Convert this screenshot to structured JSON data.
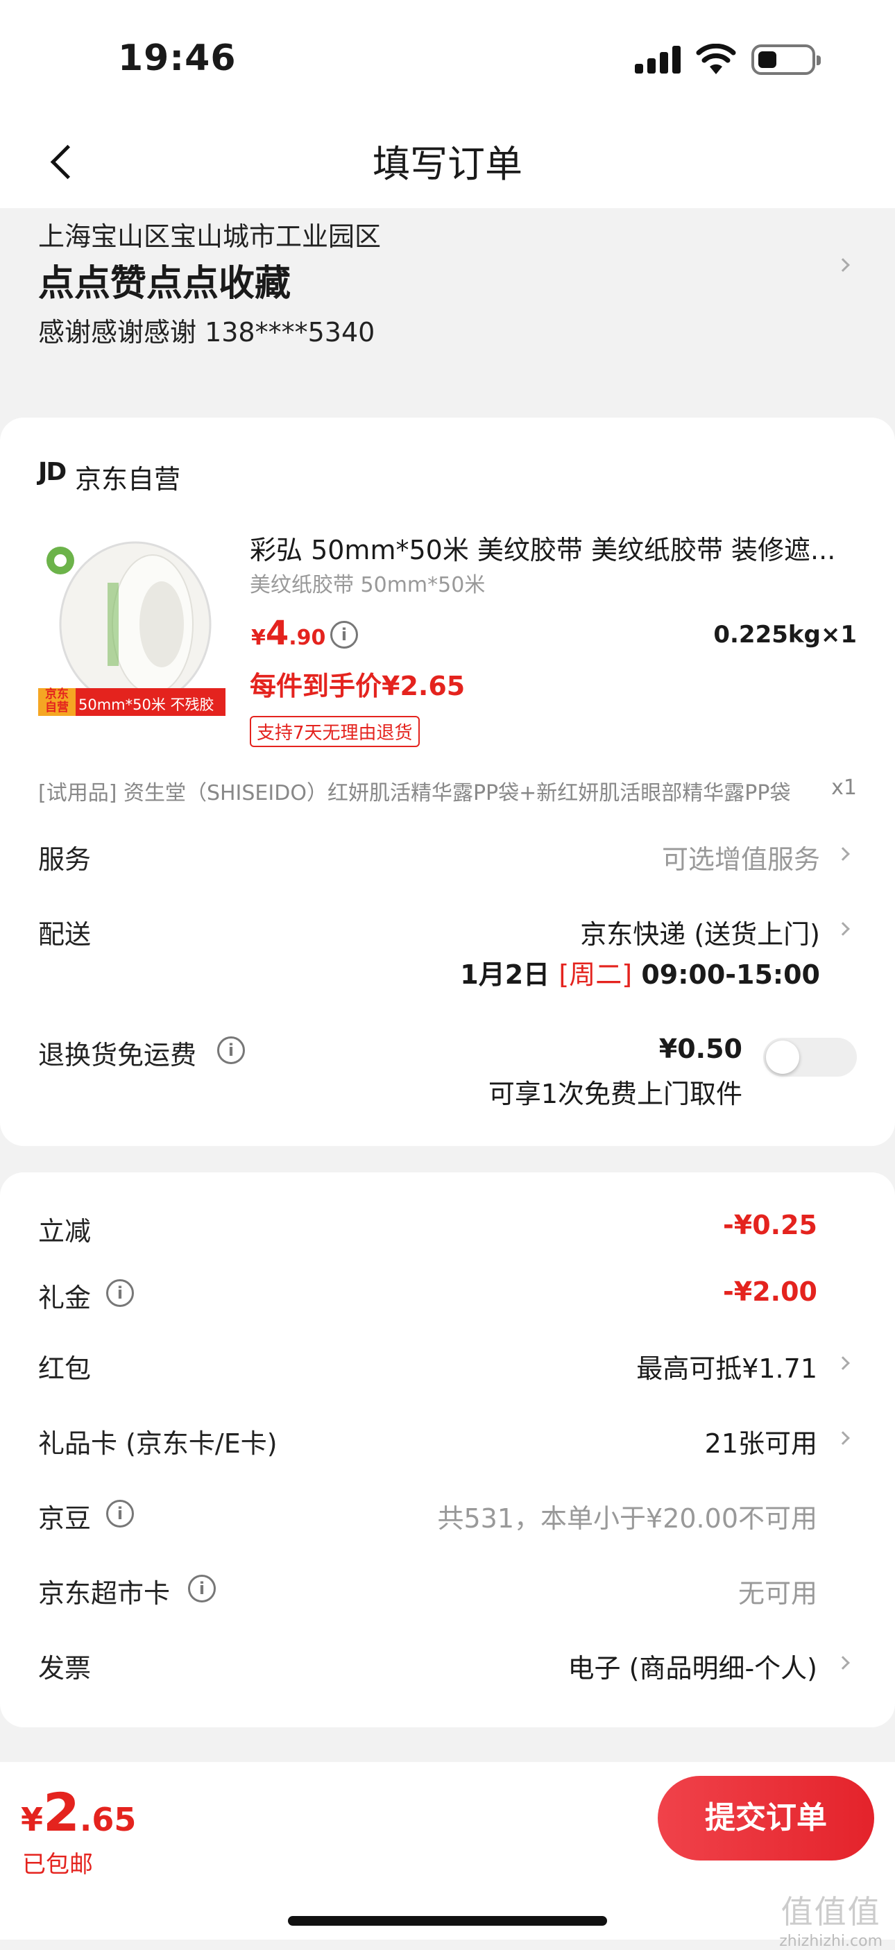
{
  "status": {
    "time": "19:46"
  },
  "header": {
    "title": "填写订单"
  },
  "address": {
    "region": "上海宝山区宝山城市工业园区",
    "name": "点点赞点点收藏",
    "contact": "感谢感谢感谢  138****5340"
  },
  "shop": {
    "logo": "JD",
    "name": "京东自营"
  },
  "product": {
    "name": "彩弘 50mm*50米 美纹胶带 美纹纸胶带 装修遮...",
    "spec": "美纹纸胶带 50mm*50米",
    "price_symbol": "¥",
    "price_int": "4",
    "price_dec": ".90",
    "weight_qty": "0.225kg×1",
    "final_price": "每件到手价¥2.65",
    "return_tag": "支持7天无理由退货",
    "image_badge_left": "京东\n自营",
    "image_badge_right": "50mm*50米 不残胶"
  },
  "trial": {
    "text": "[试用品] 资生堂（SHISEIDO）红妍肌活精华露PP袋+新红妍肌活眼部精华露PP袋",
    "qty": "x1"
  },
  "service": {
    "label": "服务",
    "value": "可选增值服务"
  },
  "delivery": {
    "label": "配送",
    "method": "京东快递 (送货上门)",
    "date": "1月2日",
    "weekday": "[周二]",
    "time": "09:00-15:00"
  },
  "return_shipping": {
    "label": "退换货免运费",
    "price": "¥0.50",
    "desc": "可享1次免费上门取件",
    "enabled": false
  },
  "discounts": {
    "instant": {
      "label": "立减",
      "value": "-¥0.25"
    },
    "gift_money": {
      "label": "礼金",
      "value": "-¥2.00"
    },
    "red_packet": {
      "label": "红包",
      "value": "最高可抵¥1.71"
    },
    "gift_card": {
      "label": "礼品卡 (京东卡/E卡)",
      "value": "21张可用"
    },
    "jd_beans": {
      "label": "京豆",
      "value": "共531，本单小于¥20.00不可用"
    },
    "supermarket_card": {
      "label": "京东超市卡",
      "value": "无可用"
    },
    "invoice": {
      "label": "发票",
      "value": "电子 (商品明细-个人)"
    }
  },
  "footer": {
    "total_symbol": "¥",
    "total_int": "2",
    "total_dec": ".65",
    "shipping": "已包邮",
    "submit_label": "提交订单"
  },
  "watermark": {
    "brand": "值值值",
    "url": "zhizhizhi.com"
  },
  "colors": {
    "accent": "#e4231e",
    "background": "#f2f2f2"
  }
}
